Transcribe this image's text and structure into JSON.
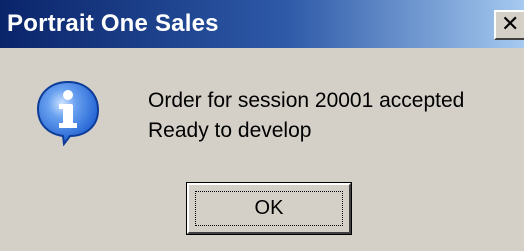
{
  "window": {
    "title": "Portrait One Sales",
    "close_icon": "close-icon",
    "title_bar_colors": [
      "#0a246a",
      "#a6caf0"
    ]
  },
  "dialog": {
    "icon": "info-icon",
    "icon_color": "#1f5fd1",
    "message_lines": [
      "Order for session 20001 accepted",
      "Ready to develop"
    ],
    "ok_label": "OK"
  }
}
